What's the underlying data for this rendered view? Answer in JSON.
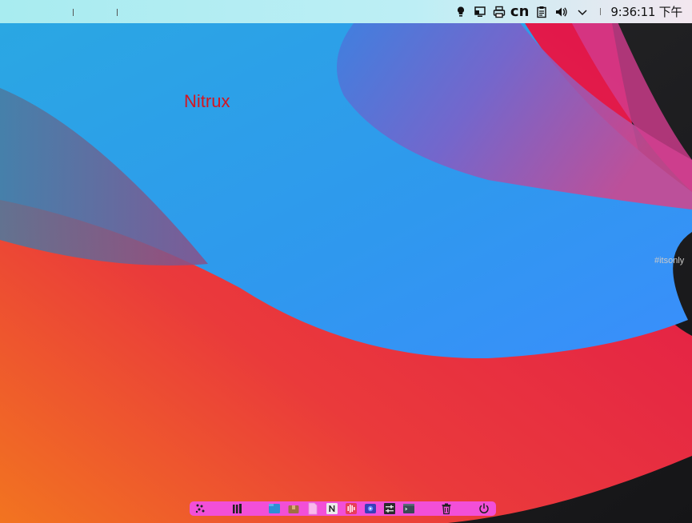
{
  "top_panel": {
    "tray": {
      "keyboard_layout": "cn",
      "clock": "9:36:11 下午",
      "icons": [
        "lightbulb-icon",
        "display-icon",
        "printer-icon",
        "clipboard-icon",
        "volume-icon",
        "chevron-down-icon"
      ]
    }
  },
  "desktop": {
    "label": "Nitrux",
    "watermark": "#itsonly"
  },
  "dock": {
    "items": [
      "app-launcher-icon",
      "library-icon",
      "file-manager-icon",
      "package-icon",
      "document-icon",
      "notes-icon",
      "audio-icon",
      "media-player-icon",
      "system-settings-icon",
      "terminal-icon",
      "trash-icon",
      "power-icon"
    ]
  },
  "colors": {
    "panel_bg": "#bdeef5",
    "dock_bg": "#f24fd8",
    "label_color": "#d4151f",
    "wallpaper_blue": "#2b9fe6",
    "wallpaper_red": "#e0104e"
  }
}
